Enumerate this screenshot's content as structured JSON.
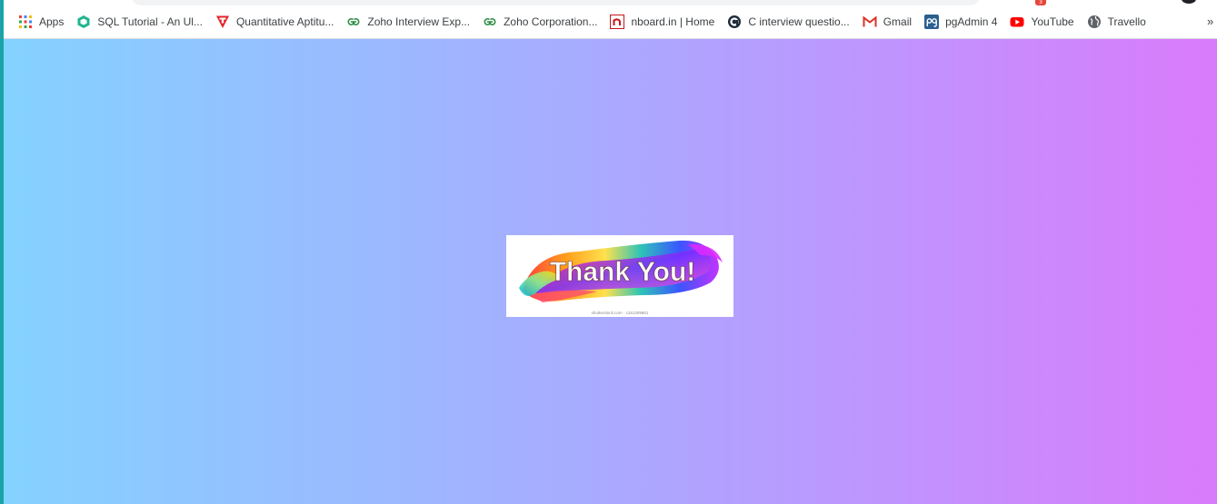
{
  "bookmarks_bar": {
    "items": [
      {
        "label": "Apps",
        "icon": "apps-grid-icon"
      },
      {
        "label": "SQL Tutorial - An Ul...",
        "icon": "sql-tutorial-icon"
      },
      {
        "label": "Quantitative Aptitu...",
        "icon": "aptitude-icon"
      },
      {
        "label": "Zoho Interview Exp...",
        "icon": "geeksforgeeks-icon"
      },
      {
        "label": "Zoho Corporation...",
        "icon": "geeksforgeeks-icon"
      },
      {
        "label": "nboard.in | Home",
        "icon": "nboard-icon"
      },
      {
        "label": "C interview questio...",
        "icon": "c-interview-icon"
      },
      {
        "label": "Gmail",
        "icon": "gmail-icon"
      },
      {
        "label": "pgAdmin 4",
        "icon": "pgadmin-icon"
      },
      {
        "label": "YouTube",
        "icon": "youtube-icon"
      },
      {
        "label": "Travello",
        "icon": "globe-icon"
      }
    ],
    "overflow_label": "»"
  },
  "toolbar": {
    "extension_badge": "3"
  },
  "page": {
    "background_colors": [
      "#84d2ff",
      "#a8abff",
      "#d97bfb"
    ],
    "image": {
      "title": "Thank You!",
      "caption": "shutterstock.com · 1151309861"
    }
  }
}
